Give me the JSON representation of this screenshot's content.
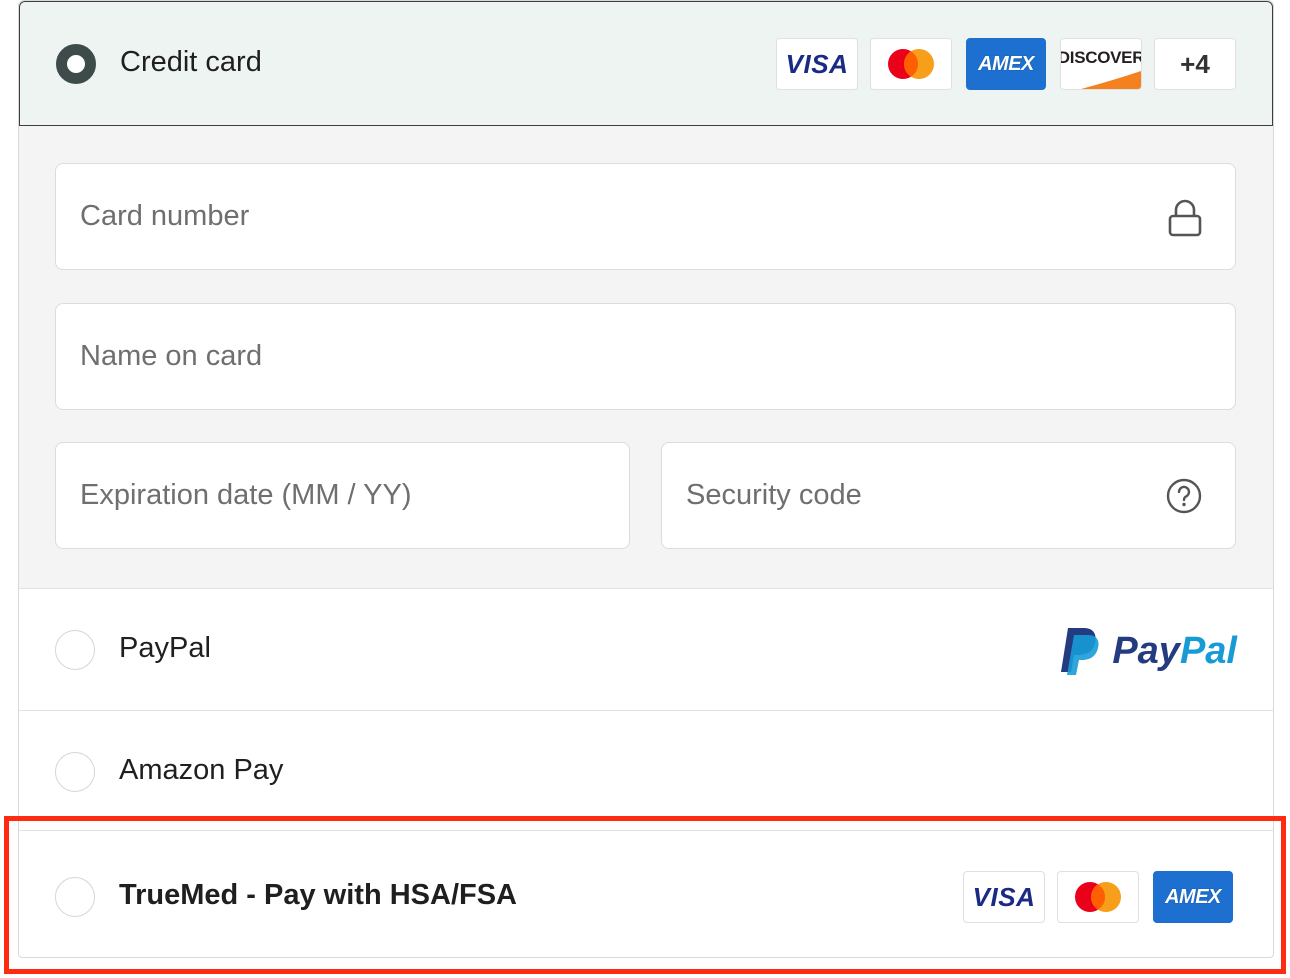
{
  "payment_methods": {
    "credit_card": {
      "label": "Credit card",
      "logos": [
        "VISA",
        "AMEX",
        "DISCOVER"
      ],
      "more_label": "+4",
      "fields": {
        "card_number": {
          "placeholder": "Card number"
        },
        "name_on_card": {
          "placeholder": "Name on card"
        },
        "expiration": {
          "placeholder": "Expiration date (MM / YY)"
        },
        "security_code": {
          "placeholder": "Security code"
        }
      }
    },
    "paypal": {
      "label": "PayPal",
      "logo_part1": "Pay",
      "logo_part2": "Pal"
    },
    "amazon_pay": {
      "label": "Amazon Pay"
    },
    "truemed": {
      "label": "TrueMed - Pay with HSA/FSA",
      "logos": [
        "VISA",
        "AMEX"
      ]
    }
  },
  "icons": {
    "card_number": "lock-icon",
    "security_code": "question-circle-icon",
    "mastercard": "mastercard-logo-icon",
    "paypal": "paypal-logo-icon"
  },
  "colors": {
    "selected_row_bg": "#eef4f1",
    "radio_selected": "#3d4b4a",
    "amex_blue": "#1d70cf",
    "visa_navy": "#1a2b85",
    "paypal_dark": "#253b80",
    "paypal_light": "#179bd7",
    "highlight_red": "#ff2a12"
  }
}
